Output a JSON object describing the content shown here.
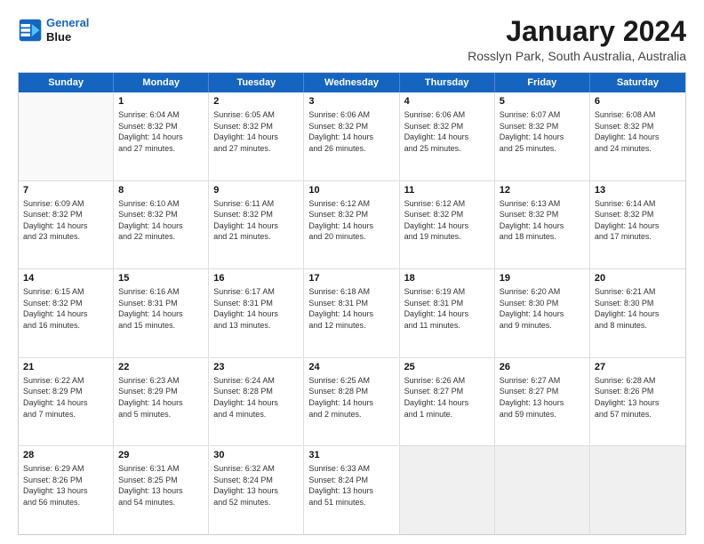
{
  "header": {
    "logo_line1": "General",
    "logo_line2": "Blue",
    "title": "January 2024",
    "subtitle": "Rosslyn Park, South Australia, Australia"
  },
  "calendar": {
    "days": [
      "Sunday",
      "Monday",
      "Tuesday",
      "Wednesday",
      "Thursday",
      "Friday",
      "Saturday"
    ],
    "rows": [
      [
        {
          "day": "",
          "content": ""
        },
        {
          "day": "1",
          "content": "Sunrise: 6:04 AM\nSunset: 8:32 PM\nDaylight: 14 hours\nand 27 minutes."
        },
        {
          "day": "2",
          "content": "Sunrise: 6:05 AM\nSunset: 8:32 PM\nDaylight: 14 hours\nand 27 minutes."
        },
        {
          "day": "3",
          "content": "Sunrise: 6:06 AM\nSunset: 8:32 PM\nDaylight: 14 hours\nand 26 minutes."
        },
        {
          "day": "4",
          "content": "Sunrise: 6:06 AM\nSunset: 8:32 PM\nDaylight: 14 hours\nand 25 minutes."
        },
        {
          "day": "5",
          "content": "Sunrise: 6:07 AM\nSunset: 8:32 PM\nDaylight: 14 hours\nand 25 minutes."
        },
        {
          "day": "6",
          "content": "Sunrise: 6:08 AM\nSunset: 8:32 PM\nDaylight: 14 hours\nand 24 minutes."
        }
      ],
      [
        {
          "day": "7",
          "content": "Sunrise: 6:09 AM\nSunset: 8:32 PM\nDaylight: 14 hours\nand 23 minutes."
        },
        {
          "day": "8",
          "content": "Sunrise: 6:10 AM\nSunset: 8:32 PM\nDaylight: 14 hours\nand 22 minutes."
        },
        {
          "day": "9",
          "content": "Sunrise: 6:11 AM\nSunset: 8:32 PM\nDaylight: 14 hours\nand 21 minutes."
        },
        {
          "day": "10",
          "content": "Sunrise: 6:12 AM\nSunset: 8:32 PM\nDaylight: 14 hours\nand 20 minutes."
        },
        {
          "day": "11",
          "content": "Sunrise: 6:12 AM\nSunset: 8:32 PM\nDaylight: 14 hours\nand 19 minutes."
        },
        {
          "day": "12",
          "content": "Sunrise: 6:13 AM\nSunset: 8:32 PM\nDaylight: 14 hours\nand 18 minutes."
        },
        {
          "day": "13",
          "content": "Sunrise: 6:14 AM\nSunset: 8:32 PM\nDaylight: 14 hours\nand 17 minutes."
        }
      ],
      [
        {
          "day": "14",
          "content": "Sunrise: 6:15 AM\nSunset: 8:32 PM\nDaylight: 14 hours\nand 16 minutes."
        },
        {
          "day": "15",
          "content": "Sunrise: 6:16 AM\nSunset: 8:31 PM\nDaylight: 14 hours\nand 15 minutes."
        },
        {
          "day": "16",
          "content": "Sunrise: 6:17 AM\nSunset: 8:31 PM\nDaylight: 14 hours\nand 13 minutes."
        },
        {
          "day": "17",
          "content": "Sunrise: 6:18 AM\nSunset: 8:31 PM\nDaylight: 14 hours\nand 12 minutes."
        },
        {
          "day": "18",
          "content": "Sunrise: 6:19 AM\nSunset: 8:31 PM\nDaylight: 14 hours\nand 11 minutes."
        },
        {
          "day": "19",
          "content": "Sunrise: 6:20 AM\nSunset: 8:30 PM\nDaylight: 14 hours\nand 9 minutes."
        },
        {
          "day": "20",
          "content": "Sunrise: 6:21 AM\nSunset: 8:30 PM\nDaylight: 14 hours\nand 8 minutes."
        }
      ],
      [
        {
          "day": "21",
          "content": "Sunrise: 6:22 AM\nSunset: 8:29 PM\nDaylight: 14 hours\nand 7 minutes."
        },
        {
          "day": "22",
          "content": "Sunrise: 6:23 AM\nSunset: 8:29 PM\nDaylight: 14 hours\nand 5 minutes."
        },
        {
          "day": "23",
          "content": "Sunrise: 6:24 AM\nSunset: 8:28 PM\nDaylight: 14 hours\nand 4 minutes."
        },
        {
          "day": "24",
          "content": "Sunrise: 6:25 AM\nSunset: 8:28 PM\nDaylight: 14 hours\nand 2 minutes."
        },
        {
          "day": "25",
          "content": "Sunrise: 6:26 AM\nSunset: 8:27 PM\nDaylight: 14 hours\nand 1 minute."
        },
        {
          "day": "26",
          "content": "Sunrise: 6:27 AM\nSunset: 8:27 PM\nDaylight: 13 hours\nand 59 minutes."
        },
        {
          "day": "27",
          "content": "Sunrise: 6:28 AM\nSunset: 8:26 PM\nDaylight: 13 hours\nand 57 minutes."
        }
      ],
      [
        {
          "day": "28",
          "content": "Sunrise: 6:29 AM\nSunset: 8:26 PM\nDaylight: 13 hours\nand 56 minutes."
        },
        {
          "day": "29",
          "content": "Sunrise: 6:31 AM\nSunset: 8:25 PM\nDaylight: 13 hours\nand 54 minutes."
        },
        {
          "day": "30",
          "content": "Sunrise: 6:32 AM\nSunset: 8:24 PM\nDaylight: 13 hours\nand 52 minutes."
        },
        {
          "day": "31",
          "content": "Sunrise: 6:33 AM\nSunset: 8:24 PM\nDaylight: 13 hours\nand 51 minutes."
        },
        {
          "day": "",
          "content": ""
        },
        {
          "day": "",
          "content": ""
        },
        {
          "day": "",
          "content": ""
        }
      ]
    ]
  }
}
